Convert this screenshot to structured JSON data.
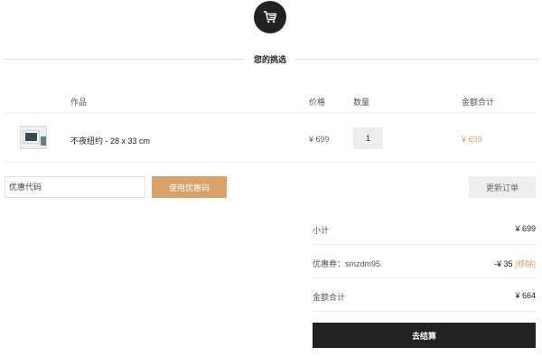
{
  "header": {
    "cart_icon": "shopping-cart-icon",
    "section_title": "您的挑选"
  },
  "table": {
    "columns": {
      "product": "作品",
      "price": "价格",
      "quantity": "数量",
      "total": "金额合计"
    },
    "rows": [
      {
        "thumbnail_icon": "framed-artwork-thumbnail",
        "name": "不夜纽约 - 28 x 33 cm",
        "price": "¥ 699",
        "quantity": "1",
        "total": "¥ 699"
      }
    ]
  },
  "coupon": {
    "placeholder": "优惠代码",
    "apply_label": "使用优惠码",
    "update_label": "更新订单"
  },
  "summary": {
    "subtotal_label": "小计",
    "subtotal_value": "¥ 699",
    "coupon_label": "优惠券：smzdm95",
    "coupon_value": "-¥ 35",
    "coupon_remove": "[移除]",
    "total_label": "金额合计",
    "total_value": "¥ 664",
    "checkout_label": "去结算"
  },
  "colors": {
    "accent": "#d8a06a",
    "dark": "#222222",
    "muted_bg": "#eeeeee"
  }
}
